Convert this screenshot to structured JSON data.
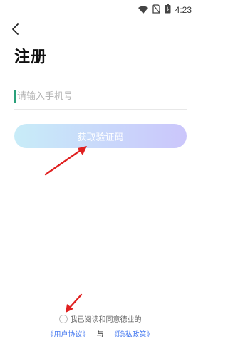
{
  "status_bar": {
    "time": "4:23",
    "icons": [
      "wifi-icon",
      "no-sim-icon",
      "battery-icon"
    ]
  },
  "nav": {
    "back_icon": "chevron-left-icon"
  },
  "title": "注册",
  "phone_field": {
    "placeholder": "请输入手机号",
    "value": ""
  },
  "get_code_button": {
    "label": "获取验证码"
  },
  "agreement": {
    "text": "我已阅读和同意德业的",
    "user_agreement": "《用户协议》",
    "and": "与",
    "privacy_policy": "《隐私政策》",
    "checked": false
  },
  "colors": {
    "accent": "#4a7cf0",
    "button_gradient_start": "#c8ecf8",
    "button_gradient_end": "#cbc6fb",
    "annotation_arrow": "#e02020"
  }
}
